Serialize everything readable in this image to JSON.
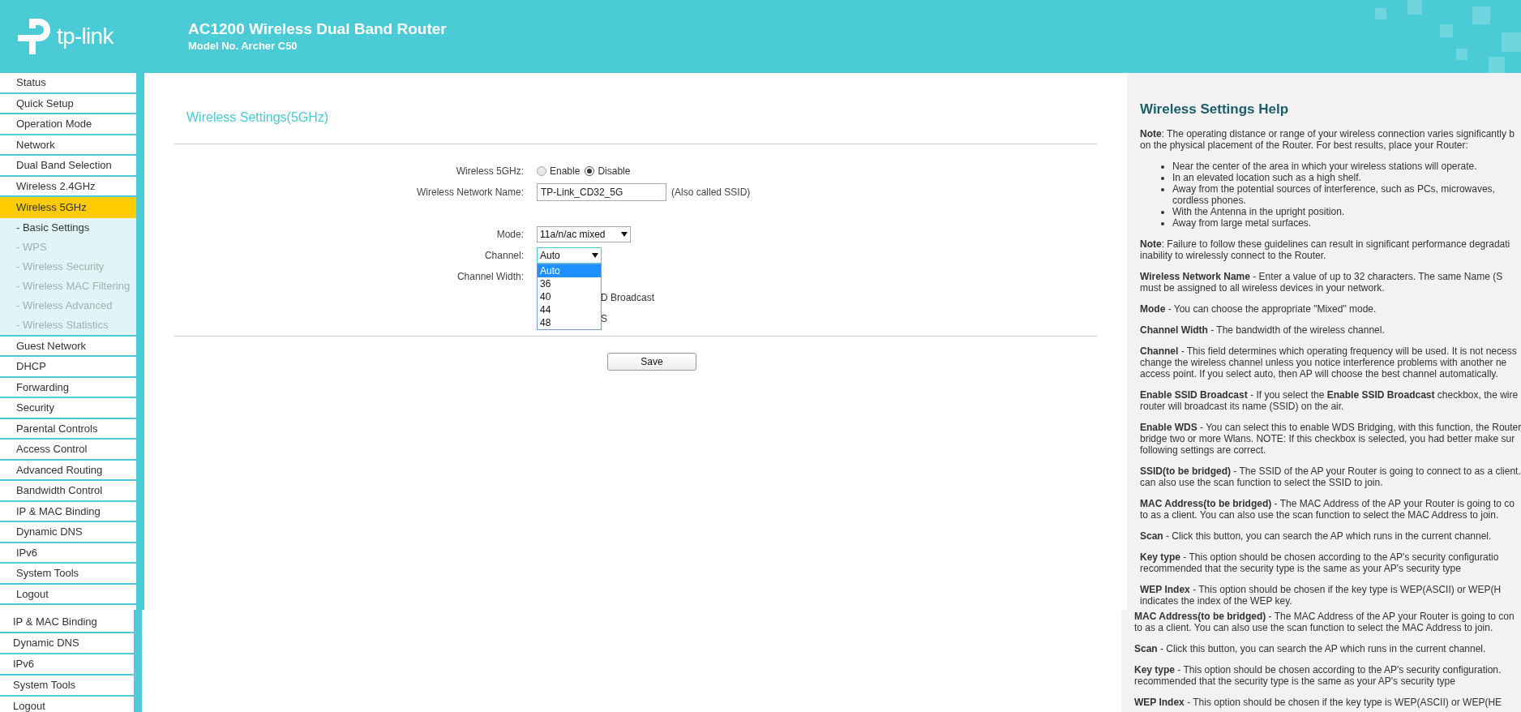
{
  "header": {
    "logo_text": "tp-link",
    "title": "AC1200 Wireless Dual Band Router",
    "subtitle": "Model No. Archer C50"
  },
  "sidebar": {
    "items": [
      {
        "label": "Status",
        "selected": false
      },
      {
        "label": "Quick Setup",
        "selected": false
      },
      {
        "label": "Operation Mode",
        "selected": false
      },
      {
        "label": "Network",
        "selected": false
      },
      {
        "label": "Dual Band Selection",
        "selected": false
      },
      {
        "label": "Wireless 2.4GHz",
        "selected": false
      },
      {
        "label": "Wireless 5GHz",
        "selected": true,
        "children": [
          {
            "label": "- Basic Settings",
            "selected": true
          },
          {
            "label": "- WPS",
            "selected": false
          },
          {
            "label": "- Wireless Security",
            "selected": false
          },
          {
            "label": "- Wireless MAC Filtering",
            "selected": false
          },
          {
            "label": "- Wireless Advanced",
            "selected": false
          },
          {
            "label": "- Wireless Statistics",
            "selected": false
          }
        ]
      },
      {
        "label": "Guest Network",
        "selected": false
      },
      {
        "label": "DHCP",
        "selected": false
      },
      {
        "label": "Forwarding",
        "selected": false
      },
      {
        "label": "Security",
        "selected": false
      },
      {
        "label": "Parental Controls",
        "selected": false
      },
      {
        "label": "Access Control",
        "selected": false
      },
      {
        "label": "Advanced Routing",
        "selected": false
      },
      {
        "label": "Bandwidth Control",
        "selected": false
      },
      {
        "label": "IP & MAC Binding",
        "selected": false
      },
      {
        "label": "Dynamic DNS",
        "selected": false
      },
      {
        "label": "IPv6",
        "selected": false
      },
      {
        "label": "System Tools",
        "selected": false
      },
      {
        "label": "Logout",
        "selected": false
      }
    ]
  },
  "sidebar_overlay": {
    "items": [
      {
        "label": "IP & MAC Binding"
      },
      {
        "label": "Dynamic DNS"
      },
      {
        "label": "IPv6"
      },
      {
        "label": "System Tools"
      },
      {
        "label": "Logout"
      }
    ]
  },
  "form": {
    "title": "Wireless Settings(5GHz)",
    "fields": [
      {
        "kind": "radio",
        "label": "Wireless 5GHz:",
        "options": [
          {
            "label": "Enable",
            "selected": false
          },
          {
            "label": "Disable",
            "selected": true
          }
        ]
      },
      {
        "kind": "text",
        "label": "Wireless Network Name:",
        "value": "TP-Link_CD32_5G",
        "note": "(Also called SSID)"
      },
      {
        "kind": "select",
        "label": "Mode:",
        "value": "11a/n/ac mixed",
        "expanded": false
      },
      {
        "kind": "select",
        "label": "Channel:",
        "value": "Auto",
        "expanded": true,
        "options": [
          {
            "label": "Auto",
            "selected": true
          },
          {
            "label": "36",
            "selected": false
          },
          {
            "label": "40",
            "selected": false
          },
          {
            "label": "44",
            "selected": false
          },
          {
            "label": "48",
            "selected": false
          }
        ]
      },
      {
        "kind": "covered",
        "label": "Channel Width:"
      }
    ],
    "covered_texts": [
      "D Broadcast",
      "S"
    ],
    "save_button": "Save"
  },
  "help": {
    "title": "Wireless Settings Help",
    "blocks": [
      {
        "kind": "para",
        "lines": [
          "**Note**: The operating distance or range of your wireless connection varies significantly b",
          "on the physical placement of the Router. For best results, place your Router:"
        ]
      },
      {
        "kind": "list",
        "items": [
          [
            "Near the center of the area in which your wireless stations will operate."
          ],
          [
            "In an elevated location such as a high shelf."
          ],
          [
            "Away from the potential sources of interference, such as PCs, microwaves,",
            "cordless phones."
          ],
          [
            "With the Antenna in the upright position."
          ],
          [
            "Away from large metal surfaces."
          ]
        ]
      },
      {
        "kind": "para",
        "lines": [
          "**Note**: Failure to follow these guidelines can result in significant performance degradati",
          "inability to wirelessly connect to the Router."
        ]
      },
      {
        "kind": "para",
        "lines": [
          "**Wireless Network Name** - Enter a value of up to 32 characters. The same Name (S",
          "must be assigned to all wireless devices in your network."
        ]
      },
      {
        "kind": "para",
        "lines": [
          "**Mode** - You can choose the appropriate \"Mixed\" mode."
        ]
      },
      {
        "kind": "para",
        "lines": [
          "**Channel Width** - The bandwidth of the wireless channel."
        ]
      },
      {
        "kind": "para",
        "lines": [
          "**Channel** - This field determines which operating frequency will be used. It is not necess",
          "change the wireless channel unless you notice interference problems with another ne",
          "access point. If you select auto, then AP will choose the best channel automatically."
        ]
      },
      {
        "kind": "para",
        "lines": [
          "**Enable SSID Broadcast** - If you select the **Enable SSID Broadcast** checkbox, the wire",
          "router will broadcast its name (SSID) on the air."
        ]
      },
      {
        "kind": "para",
        "lines": [
          "**Enable WDS** - You can select this to enable WDS Bridging, with this function, the Router",
          "bridge two or more Wlans. NOTE: If this checkbox is selected, you had better make sur",
          "following settings are correct."
        ]
      },
      {
        "kind": "para",
        "lines": [
          "**SSID(to be bridged)** - The SSID of the AP your Router is going to connect to as a client.",
          "can also use the scan function to select the SSID to join."
        ]
      },
      {
        "kind": "para",
        "lines": [
          "**MAC Address(to be bridged)** - The MAC Address of the AP your Router is going to co",
          "to as a client. You can also use the scan function to select the MAC Address to join."
        ]
      },
      {
        "kind": "para",
        "lines": [
          "**Scan** - Click this button, you can search the AP which runs in the current channel."
        ]
      },
      {
        "kind": "para",
        "lines": [
          "**Key type** - This option should be chosen according to the AP's security configuratio",
          "recommended that the security type is the same as your AP's security type"
        ]
      },
      {
        "kind": "para",
        "lines": [
          "**WEP Index** - This option should be chosen if the key type is WEP(ASCII) or WEP(H",
          "indicates the index of the WEP key."
        ]
      }
    ]
  },
  "help_overlay": {
    "blocks": [
      {
        "kind": "para",
        "lines": [
          "**MAC Address(to be bridged)** - The MAC Address of the AP your Router is going to con",
          "to as a client. You can also use the scan function to select the MAC Address to join."
        ]
      },
      {
        "kind": "para",
        "lines": [
          "**Scan** - Click this button, you can search the AP which runs in the current channel."
        ]
      },
      {
        "kind": "para",
        "lines": [
          "**Key type** - This option should be chosen according to the AP's security configuration.",
          "recommended that the security type is the same as your AP's security type"
        ]
      },
      {
        "kind": "para",
        "lines": [
          "**WEP Index** - This option should be chosen if the key type is WEP(ASCII) or WEP(HE"
        ]
      }
    ]
  }
}
